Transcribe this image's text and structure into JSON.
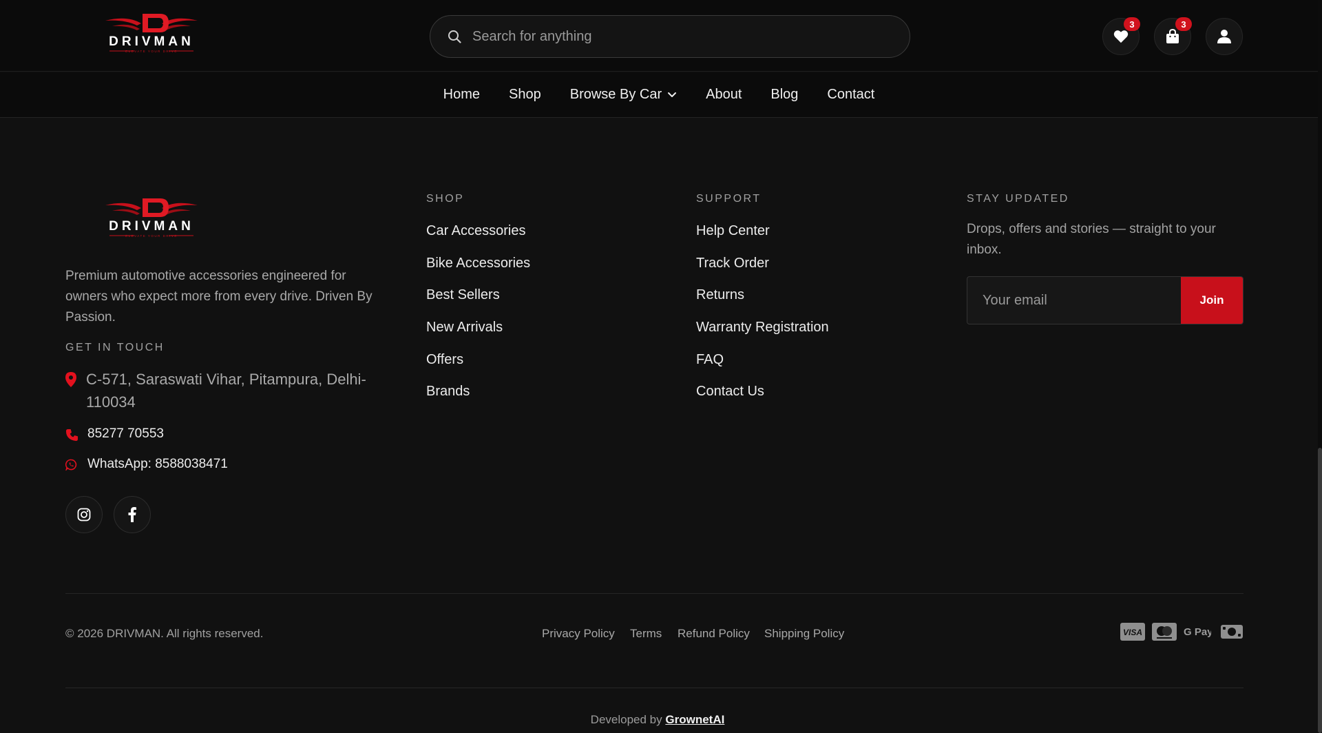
{
  "brand": {
    "name": "DRIVMAN",
    "tagline": "ELEVATE YOUR DRIVE",
    "accent": "#c8101b"
  },
  "header": {
    "search_placeholder": "Search for anything",
    "wishlist_count": "3",
    "cart_count": "3"
  },
  "nav": {
    "items": [
      {
        "label": "Home"
      },
      {
        "label": "Shop"
      },
      {
        "label": "Browse By Car"
      },
      {
        "label": "About"
      },
      {
        "label": "Blog"
      },
      {
        "label": "Contact"
      }
    ]
  },
  "footer": {
    "description": "Premium automotive accessories engineered for owners who expect more from every drive. Driven By Passion.",
    "contact_heading": "GET IN TOUCH",
    "address": "C-571, Saraswati Vihar, Pitampura, Delhi-110034",
    "phone": "85277 70553",
    "whatsapp": "WhatsApp: 8588038471",
    "social": [
      "instagram-icon",
      "facebook-icon"
    ],
    "shop": {
      "heading": "SHOP",
      "links": [
        "Car Accessories",
        "Bike Accessories",
        "Best Sellers",
        "New Arrivals",
        "Offers",
        "Brands"
      ]
    },
    "support": {
      "heading": "SUPPORT",
      "links": [
        "Help Center",
        "Track Order",
        "Returns",
        "Warranty Registration",
        "FAQ",
        "Contact Us"
      ]
    },
    "newsletter": {
      "heading": "STAY UPDATED",
      "text": "Drops, offers and stories — straight to your inbox.",
      "email_placeholder": "Your email",
      "join_label": "Join"
    },
    "copyright": "© 2026 DRIVMAN. All rights reserved.",
    "policies": [
      "Privacy Policy",
      "Terms",
      "Refund Policy",
      "Shipping Policy"
    ],
    "payments": [
      "visa-icon",
      "mastercard-icon",
      "gpay-icon",
      "cash-icon"
    ],
    "gpay_text": "G Pay",
    "visa_text": "VISA",
    "developed_by": "Developed by",
    "developer": "GrownetAI"
  }
}
